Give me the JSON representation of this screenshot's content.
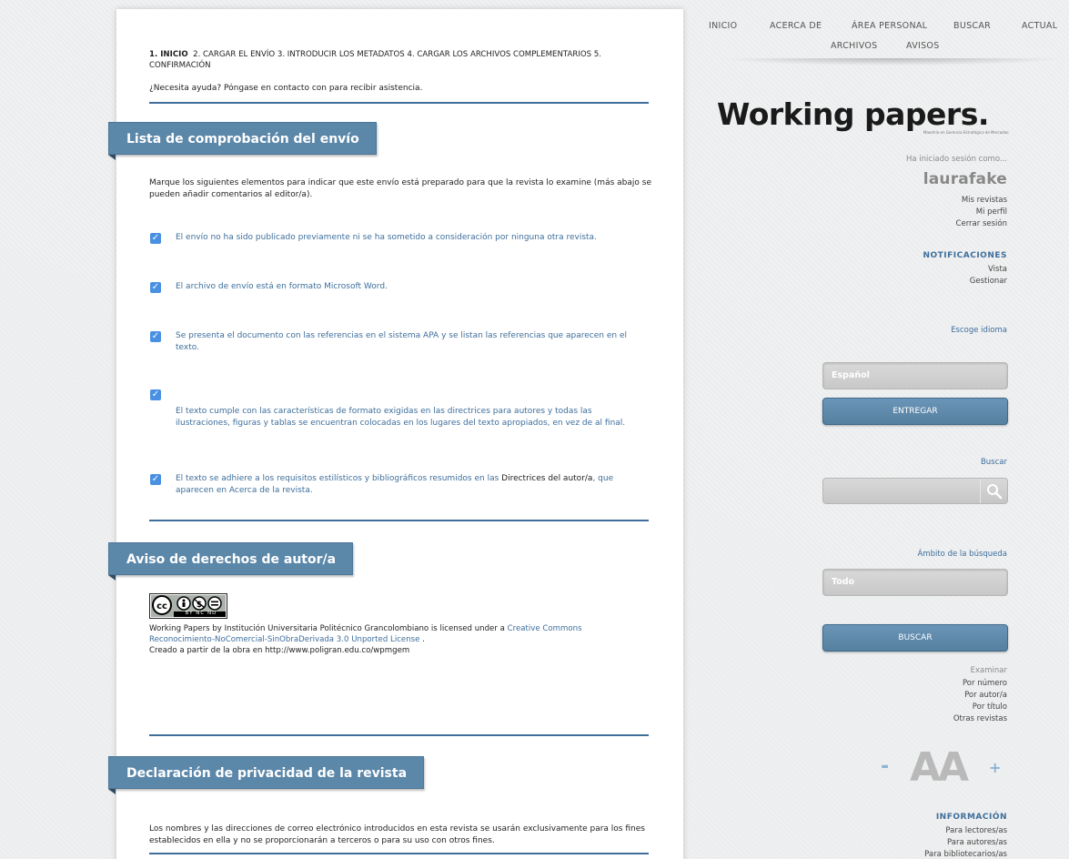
{
  "steps": {
    "step1": "1. INICIO",
    "rest": "2. CARGAR EL ENVÍO  3. INTRODUCIR LOS METADATOS  4. CARGAR LOS ARCHIVOS COMPLEMENTARIOS  5. CONFIRMACIÓN"
  },
  "help_text": "¿Necesita ayuda? Póngase en contacto con  para recibir asistencia.",
  "checklist": {
    "title": "Lista de comprobación del envío",
    "intro": "Marque los siguientes elementos para indicar que este envío está preparado para que la revista lo examine (más abajo se pueden añadir comentarios al editor/a).",
    "items": [
      {
        "text": "El envío no ha sido publicado previamente ni se ha sometido a consideración por ninguna otra revista.",
        "checked": true
      },
      {
        "text": "El archivo de envío está en formato Microsoft Word.",
        "checked": true
      },
      {
        "text": "Se presenta el documento con las referencias en el sistema APA  y se listan las referencias que aparecen en el texto.",
        "checked": true
      },
      {
        "text": "El texto cumple con las características de formato exigidas en las directrices para autores y todas las ilustraciones, figuras y tablas se encuentran colocadas en los lugares del texto apropiados, en vez de al final.",
        "checked": true
      },
      {
        "text_before": "El texto se adhiere a los requisitos estilísticos y bibliográficos resumidos en las ",
        "link": "Directrices del autor/a",
        "text_after": ", que aparecen en Acerca de la revista.",
        "checked": true
      }
    ]
  },
  "copyright": {
    "title": "Aviso de derechos de autor/a",
    "badge_text": "BY  NC  ND",
    "line1_prefix": "Working Papers by Institución Universitaria Politécnico Grancolombiano is licensed under a ",
    "line1_link": "Creative Commons",
    "line2_link": "Reconocimiento-NoComercial-SinObraDerivada 3.0 Unported License",
    "line2_suffix": " .",
    "line3": "Creado a partir de la obra en http://www.poligran.edu.co/wpmgem"
  },
  "privacy": {
    "title": "Declaración de privacidad de la revista",
    "text": "Los nombres y las direcciones de correo electrónico introducidos en esta revista se usarán exclusivamente para los fines establecidos en ella y no se proporcionarán a terceros o para su uso con otros fines."
  },
  "nav": {
    "inicio": "INICIO",
    "acerca": "ACERCA DE",
    "area": "ÁREA PERSONAL",
    "buscar": "BUSCAR",
    "actual": "ACTUAL",
    "archivos": "ARCHIVOS",
    "avisos": "AVISOS"
  },
  "logo": {
    "title": "Working papers.",
    "subtitle": "Maestría en Gerencia Estratégica de Mercadeo"
  },
  "user": {
    "logged_in_as": "Ha iniciado sesión como...",
    "username": "laurafake",
    "links": [
      "Mis revistas",
      "Mi perfil",
      "Cerrar sesión"
    ]
  },
  "notifications": {
    "title": "NOTIFICACIONES",
    "links": [
      "Vista",
      "Gestionar"
    ]
  },
  "language": {
    "label": "Escoge idioma",
    "selected": "Español",
    "submit": "ENTREGAR"
  },
  "search": {
    "label": "Buscar",
    "value": "",
    "scope_label": "Ámbito de la búsqueda",
    "scope_selected": "Todo",
    "submit": "BUSCAR"
  },
  "browse": {
    "title": "Examinar",
    "links": [
      "Por número",
      "Por autor/a",
      "Por título",
      "Otras revistas"
    ]
  },
  "font_size": {
    "decrease": "-",
    "glyph": "AA",
    "increase": "+"
  },
  "info": {
    "title": "INFORMACIÓN",
    "links": [
      "Para lectores/as",
      "Para autores/as",
      "Para bibliotecarios/as"
    ]
  }
}
